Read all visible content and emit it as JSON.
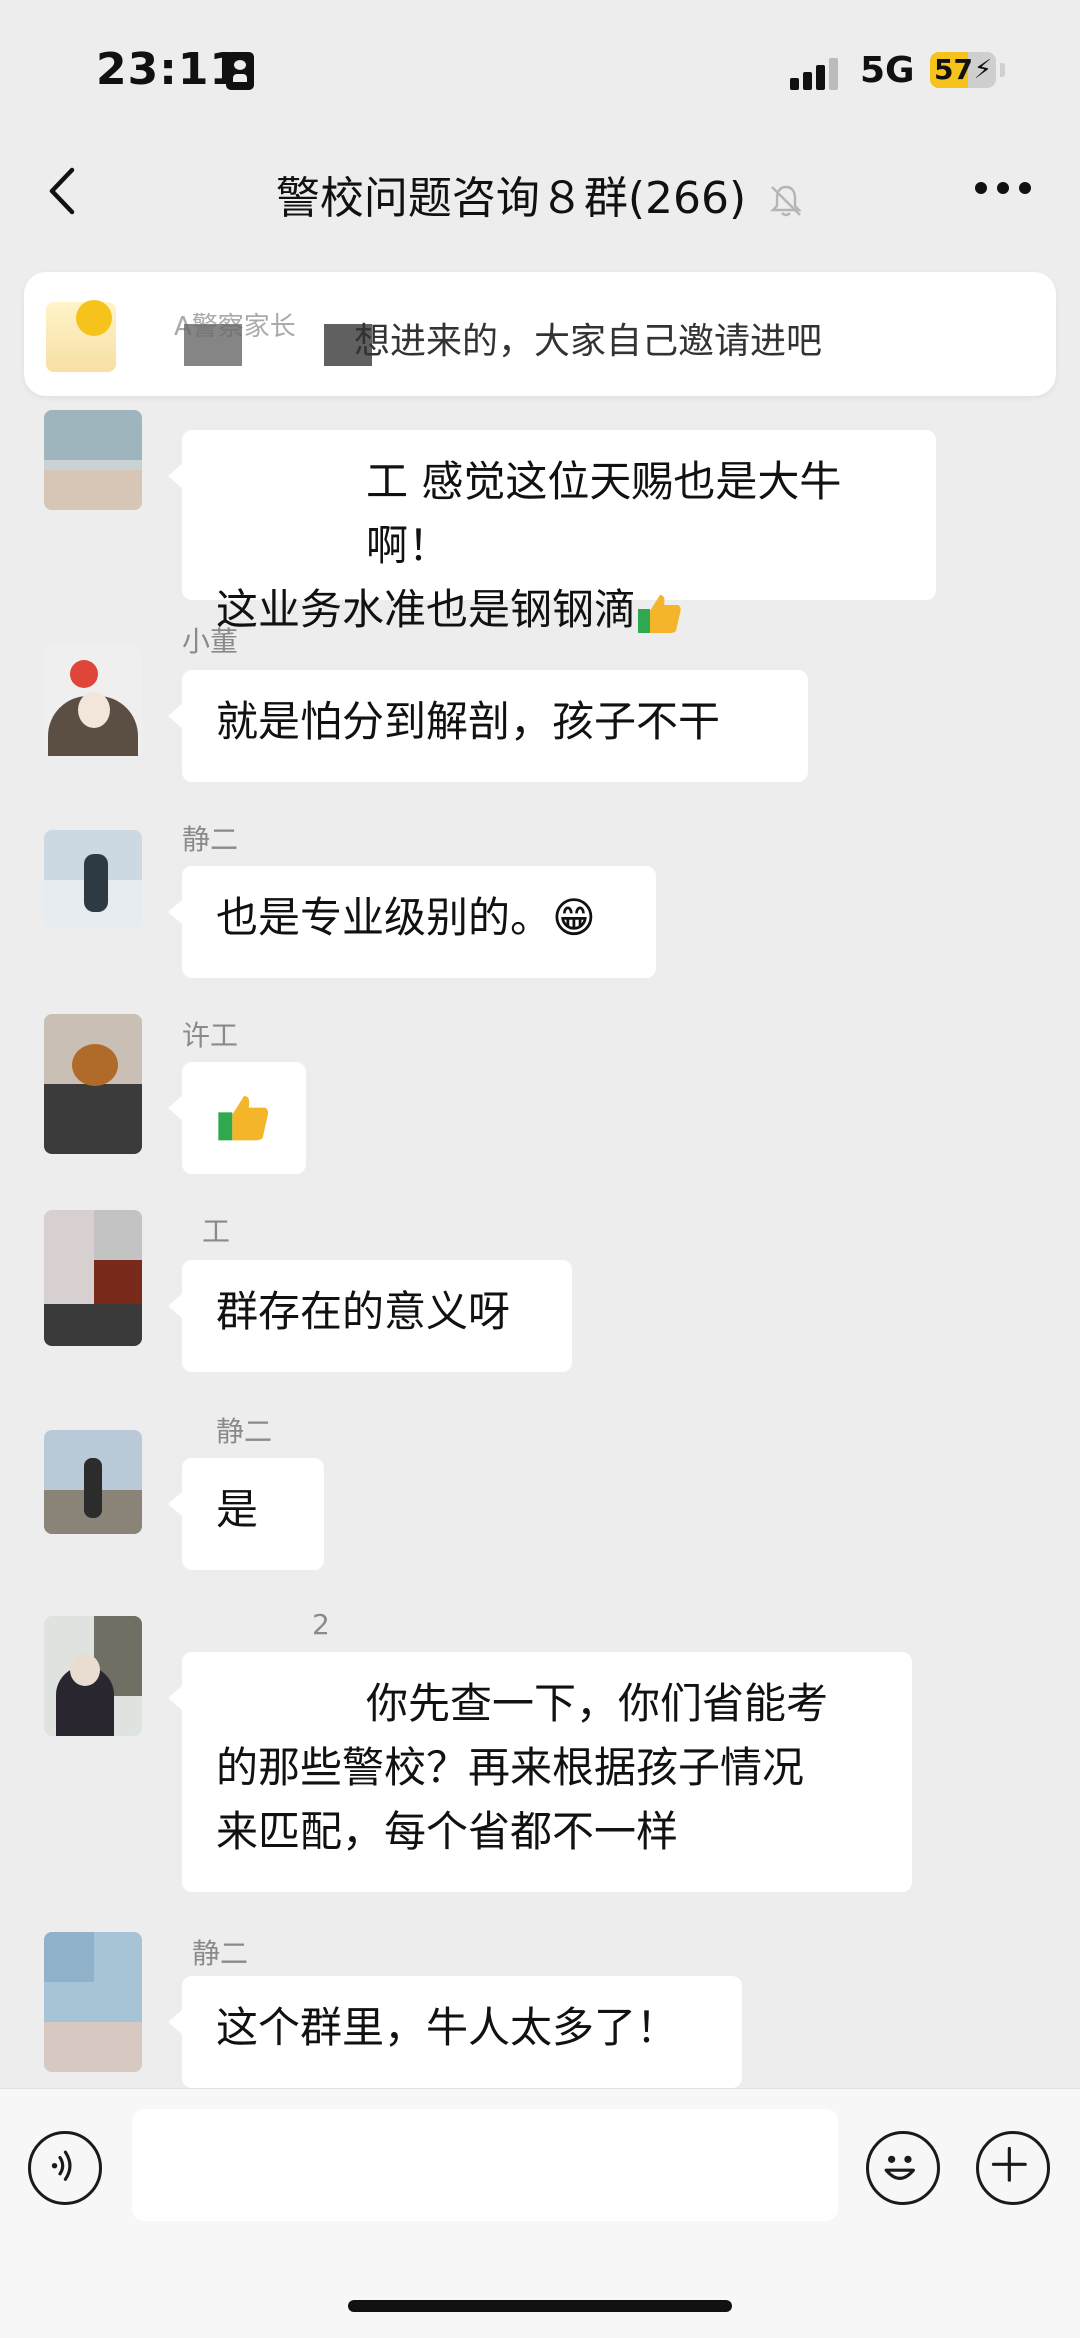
{
  "status_bar": {
    "time": "23:11",
    "network": "5G",
    "battery": "57",
    "battery_level_percent": 57,
    "signal_bars": 3
  },
  "header": {
    "title": "警校问题咨询８群(266)",
    "muted": true
  },
  "pinned_notice": {
    "text": "想进来的，大家自己邀请进吧",
    "faint_prefix": "A警察家长"
  },
  "messages": [
    {
      "sender": "",
      "text_line1": "工 感觉这位天赐也是大牛啊！",
      "text_line2": "这业务水准也是钢钢滴",
      "trailing_emoji": "thumbs-up"
    },
    {
      "sender": "小董",
      "text": "就是怕分到解剖，孩子不干"
    },
    {
      "sender": "静二",
      "text": "也是专业级别的。😁"
    },
    {
      "sender": "许工",
      "text": "",
      "emoji": "thumbs-up"
    },
    {
      "sender": "工",
      "text": "群存在的意义呀"
    },
    {
      "sender": "静二",
      "text": "是"
    },
    {
      "sender": "2",
      "text_line1": "你先查一下，你们省能考",
      "text_line2": "的那些警校？再来根据孩子情况",
      "text_line3": "来匹配，每个省都不一样"
    },
    {
      "sender": "静二",
      "text": "这个群里，牛人太多了！"
    }
  ],
  "input_bar": {
    "placeholder": "",
    "icons": [
      "voice-icon",
      "emoji-icon",
      "plus-icon"
    ]
  },
  "colors": {
    "background": "#ededed",
    "bubble": "#ffffff",
    "battery": "#f6c21c"
  }
}
